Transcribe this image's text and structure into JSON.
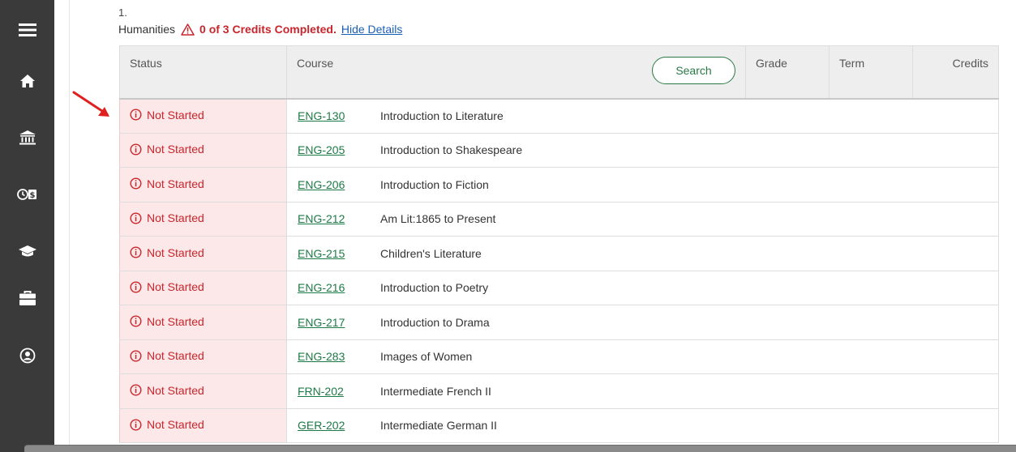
{
  "sidebar": {
    "icons": [
      "menu-icon",
      "home-icon",
      "institution-icon",
      "finance-icon",
      "graduation-cap-icon",
      "briefcase-icon",
      "user-circle-icon"
    ]
  },
  "requirement": {
    "number": "1.",
    "title": "Humanities",
    "credits_status": "0 of 3 Credits Completed.",
    "toggle_label": "Hide Details"
  },
  "table": {
    "headers": {
      "status": "Status",
      "course": "Course",
      "grade": "Grade",
      "term": "Term",
      "credits": "Credits"
    },
    "search_label": "Search",
    "rows": [
      {
        "status": "Not Started",
        "code": "ENG-130",
        "title": "Introduction to Literature"
      },
      {
        "status": "Not Started",
        "code": "ENG-205",
        "title": "Introduction to Shakespeare"
      },
      {
        "status": "Not Started",
        "code": "ENG-206",
        "title": "Introduction to Fiction"
      },
      {
        "status": "Not Started",
        "code": "ENG-212",
        "title": "Am Lit:1865 to Present"
      },
      {
        "status": "Not Started",
        "code": "ENG-215",
        "title": "Children's Literature"
      },
      {
        "status": "Not Started",
        "code": "ENG-216",
        "title": "Introduction to Poetry"
      },
      {
        "status": "Not Started",
        "code": "ENG-217",
        "title": "Introduction to Drama"
      },
      {
        "status": "Not Started",
        "code": "ENG-283",
        "title": "Images of Women"
      },
      {
        "status": "Not Started",
        "code": "FRN-202",
        "title": "Intermediate French II"
      },
      {
        "status": "Not Started",
        "code": "GER-202",
        "title": "Intermediate German II"
      }
    ]
  },
  "colors": {
    "sidebar_bg": "#3a3a3a",
    "status_red": "#c9252c",
    "status_bg": "#fce8e8",
    "link_green": "#1d7a46",
    "link_blue": "#1a5fb4",
    "annotation_arrow": "#e0201e"
  }
}
